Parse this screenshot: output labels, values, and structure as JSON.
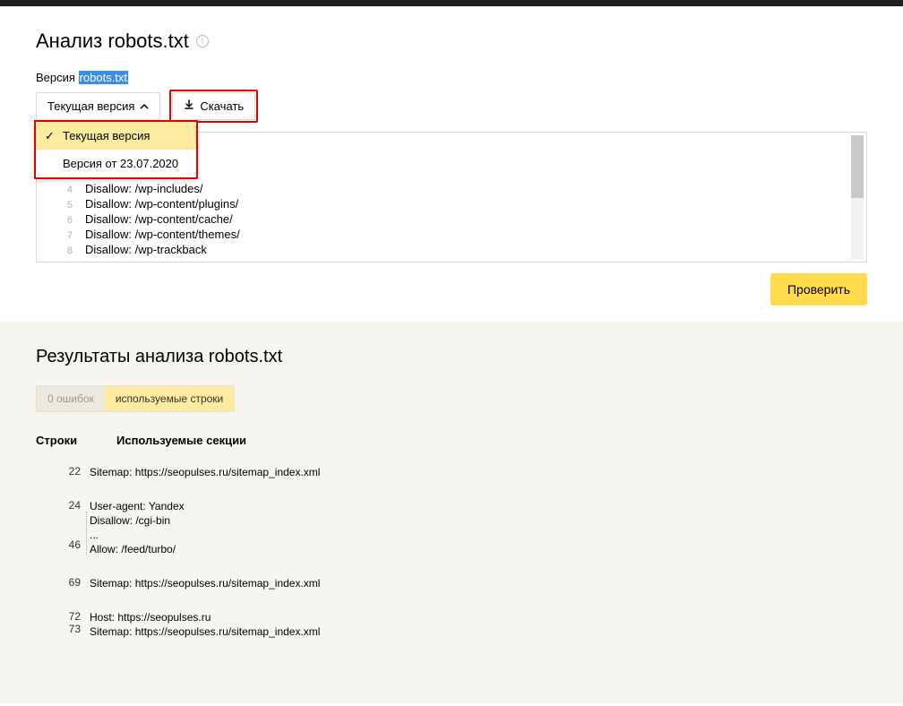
{
  "header": {
    "title": "Анализ robots.txt"
  },
  "version": {
    "label_prefix": "Версия",
    "label_file": "robots.txt",
    "selector_label": "Текущая версия",
    "options": [
      {
        "label": "Текущая версия",
        "active": true
      },
      {
        "label": "Версия от 23.07.2020",
        "active": false
      }
    ]
  },
  "download_label": "Скачать",
  "code": [
    {
      "n": "4",
      "text": "Disallow: /wp-includes/"
    },
    {
      "n": "5",
      "text": "Disallow: /wp-content/plugins/"
    },
    {
      "n": "6",
      "text": "Disallow: /wp-content/cache/"
    },
    {
      "n": "7",
      "text": "Disallow: /wp-content/themes/"
    },
    {
      "n": "8",
      "text": "Disallow: /wp-trackback"
    }
  ],
  "check_label": "Проверить",
  "results": {
    "title": "Результаты анализа robots.txt",
    "tabs": {
      "errors": "0 ошибок",
      "used": "используемые строки"
    },
    "columns": {
      "lines": "Строки",
      "sections": "Используемые секции"
    },
    "rows": [
      {
        "line_from": "22",
        "lines": [
          "Sitemap: https://seopulses.ru/sitemap_index.xml"
        ]
      },
      {
        "line_from": "24",
        "line_to": "46",
        "lines": [
          "User-agent: Yandex",
          "Disallow: /cgi-bin",
          "...",
          "Allow: /feed/turbo/"
        ]
      },
      {
        "line_from": "69",
        "lines": [
          "Sitemap: https://seopulses.ru/sitemap_index.xml"
        ]
      },
      {
        "line_from": "72",
        "line_to": "73",
        "lines": [
          "Host: https://seopulses.ru",
          "Sitemap: https://seopulses.ru/sitemap_index.xml"
        ]
      }
    ]
  }
}
